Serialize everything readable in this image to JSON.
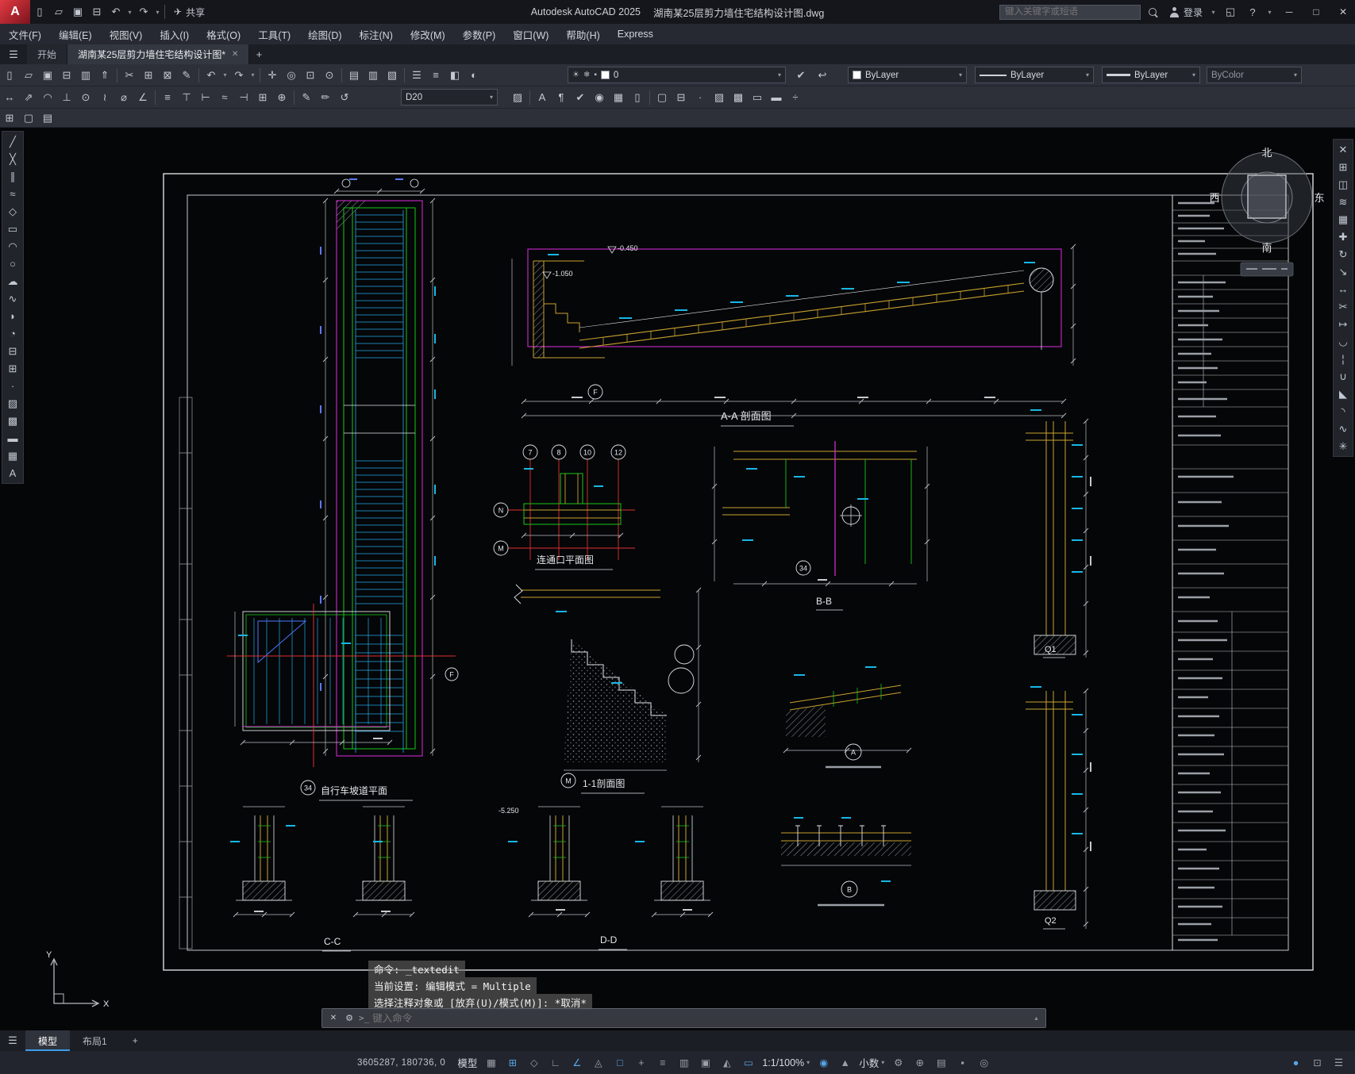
{
  "titlebar": {
    "share_label": "共享",
    "app_title": "Autodesk AutoCAD 2025",
    "doc_title": "湖南某25层剪力墙住宅结构设计图.dwg",
    "search_placeholder": "键入关键字或短语",
    "login_label": "登录"
  },
  "menubar": {
    "items": [
      "文件(F)",
      "编辑(E)",
      "视图(V)",
      "插入(I)",
      "格式(O)",
      "工具(T)",
      "绘图(D)",
      "标注(N)",
      "修改(M)",
      "参数(P)",
      "窗口(W)",
      "帮助(H)",
      "Express"
    ]
  },
  "filetabs": {
    "start": "开始",
    "drawing": "湖南某25层剪力墙住宅结构设计图*"
  },
  "toolbar": {
    "style_value": "D20",
    "layer_value": "0",
    "color_value": "ByLayer",
    "linetype_value": "ByLayer",
    "lineweight_value": "ByLayer",
    "plotstyle_value": "ByColor"
  },
  "viewcube": {
    "north": "北",
    "south": "南",
    "west": "西",
    "east": "东"
  },
  "ucs": {
    "x": "X",
    "y": "Y"
  },
  "drawing": {
    "labels": {
      "section_aa": "A-A 剖面图",
      "plan_connect": "连通口平面图",
      "section_bb": "B-B",
      "section_11": "1-1剖面图",
      "plan_ramp": "自行车坡道平面",
      "section_cc": "C-C",
      "section_dd": "D-D",
      "wall_q1": "Q1",
      "wall_q2": "Q2"
    },
    "bubbles": {
      "g7": "7",
      "g8": "8",
      "g10": "10",
      "g12": "12",
      "gN": "N",
      "gM": "M",
      "gF": "F",
      "g34": "34",
      "gA": "A",
      "gB": "B"
    },
    "elevations": {
      "e1": "-0.450",
      "e2": "-1.050",
      "e3": "-5.250"
    }
  },
  "command_overlay": {
    "line1": "命令: _textedit",
    "line2": "当前设置: 编辑模式 = Multiple",
    "line3": "选择注释对象或 [放弃(U)/模式(M)]: *取消*"
  },
  "command_input": {
    "placeholder": "键入命令"
  },
  "layout_tabs": {
    "model": "模型",
    "layout1": "布局1",
    "add": "+"
  },
  "statusbar": {
    "coordinates": "3605287, 180736, 0",
    "model_label": "模型",
    "scale_label": "1:1/100%",
    "units_label": "小数"
  },
  "icons": {
    "logo": "A",
    "qnew": "▯",
    "open": "▱",
    "save": "▣",
    "plot": "⊟",
    "preview": "▥",
    "publish": "⇑",
    "cut": "✂",
    "copy": "⊞",
    "paste": "⊠",
    "matchprop": "✎",
    "undo": "↶",
    "redo": "↷",
    "share": "✈",
    "chev": "▾",
    "chevup": "▴",
    "min": "─",
    "max": "□",
    "close": "✕",
    "help": "?",
    "cart": "◱",
    "hamburger": "☰",
    "plus": "+",
    "pan": "✛",
    "zoom": "◎",
    "zoomwin": "⊡",
    "zoomprev": "⊙",
    "props": "▤",
    "dcenter": "▥",
    "palettes": "▧",
    "lman": "☰",
    "lstates": "≡",
    "liso": "◧",
    "loff": "◐",
    "sun": "☀",
    "freeze": "❄",
    "lock": "▪",
    "mkcur": "✔",
    "lprev": "↩",
    "dimlin": "↔",
    "dimalign": "⇗",
    "dimarcd": "◠",
    "dimord": "⊥",
    "dimrad": "⊙",
    "dimjog": "≀",
    "dimdia": "⌀",
    "dimang": "∠",
    "qdim": "≡",
    "dimbase": "⊤",
    "dimcont": "⊢",
    "dimspace": "≈",
    "dimbreak": "⊣",
    "tol": "⊞",
    "center": "⊕",
    "dimedit": "✎",
    "dimtedit": "✏",
    "dimupd": "↺",
    "dstyle": "▨",
    "text": "A",
    "mtextp": "¶",
    "spell": "✔",
    "find": "◉",
    "table": "▦",
    "field": "▯",
    "block": "▢",
    "insert": "⊟",
    "pointd": "∙",
    "hatch": "▨",
    "gradient": "▩",
    "boundary": "▭",
    "region": "▬",
    "measure": "÷",
    "vports": "⊞",
    "views": "▢",
    "sheet": "▤",
    "line": "╱",
    "xline": "╳",
    "mline": "∥",
    "pline": "≈",
    "polygon": "◇",
    "rect": "▭",
    "arc": "◠",
    "circle": "○",
    "revcloud": "☁",
    "spline": "∿",
    "ellipse": "◗",
    "earc": "◔",
    "insblock": "⊟",
    "mkblock": "⊞",
    "erase": "✕",
    "mirror": "◫",
    "offset": "≋",
    "array": "▦",
    "move": "✚",
    "rotate": "↻",
    "scale": "↘",
    "stretch": "↔",
    "trim": "✂",
    "extend": "↦",
    "breakpt": "◡",
    "break": "¦",
    "join": "∪",
    "chamfer": "◣",
    "fillet": "◝",
    "blend": "∿",
    "explode": "✳",
    "grid": "▦",
    "snap": "⊞",
    "infer": "◇",
    "ortho": "∟",
    "polar": "∠",
    "iso": "◬",
    "osnap": "□",
    "otrack": "+",
    "lwt": "≡",
    "transp": "▥",
    "cycle": "▣",
    "ducs": "◭",
    "dyn": "▭",
    "annovis": "◉",
    "autoscale": "▲",
    "gear": "⚙",
    "annomon": "⊕",
    "qprops": "▤",
    "lockui": "▪",
    "isolate": "◎",
    "perf": "●",
    "clean": "⊡",
    "customize": "☰",
    "prompt": ">_"
  }
}
